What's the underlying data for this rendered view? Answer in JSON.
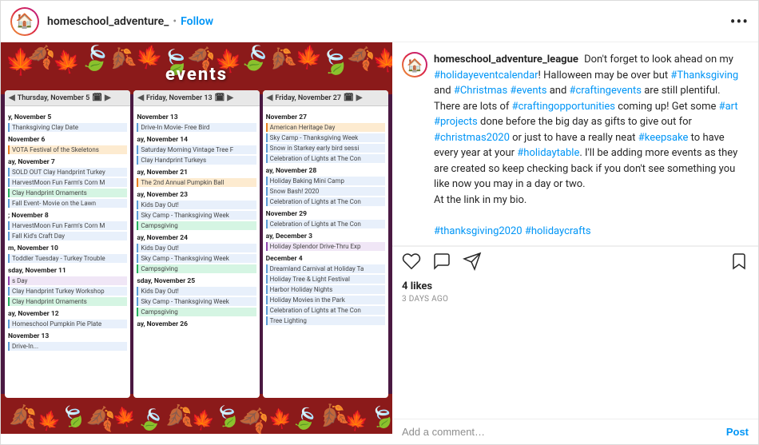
{
  "header": {
    "username": "homeschool_adventure_",
    "follow_label": "Follow",
    "more_label": "•••",
    "dot": "•"
  },
  "post": {
    "image_alt": "Holiday event calendar screenshot"
  },
  "caption": {
    "username": "homeschool_adventure_league",
    "text_parts": [
      {
        "text": "Don't forget to look ahead on my "
      },
      {
        "text": "#holidayeventcalendar",
        "type": "hashtag"
      },
      {
        "text": "! Halloween may be over but "
      },
      {
        "text": "#Thanksgiving",
        "type": "hashtag"
      },
      {
        "text": " and "
      },
      {
        "text": "#Christmas",
        "type": "hashtag"
      },
      {
        "text": " "
      },
      {
        "text": "#events",
        "type": "hashtag"
      },
      {
        "text": " and "
      },
      {
        "text": "#craftingevents",
        "type": "hashtag"
      },
      {
        "text": " are still plentiful. There are lots of "
      },
      {
        "text": "#craftingopportunities",
        "type": "hashtag"
      },
      {
        "text": " coming up! Get some "
      },
      {
        "text": "#art",
        "type": "hashtag"
      },
      {
        "text": " "
      },
      {
        "text": "#projects",
        "type": "hashtag"
      },
      {
        "text": " done before the big day as gifts to give out for "
      },
      {
        "text": "#christmas2020",
        "type": "hashtag"
      },
      {
        "text": " or just to have a really neat "
      },
      {
        "text": "#keepsake",
        "type": "hashtag"
      },
      {
        "text": " to have every year at your "
      },
      {
        "text": "#holidaytable",
        "type": "hashtag"
      },
      {
        "text": ". I'll be adding more events as they are created so keep checking back if you don't see something you like now you may in a day or two.\nAt the link in my bio."
      },
      {
        "text": "\n\n"
      },
      {
        "text": "#thanksgiving2020 #holidaycrafts",
        "type": "hashtag"
      }
    ]
  },
  "stats": {
    "likes": "4 likes",
    "time_ago": "3 days ago"
  },
  "add_comment": {
    "placeholder": "Add a comment…",
    "post_label": "Post"
  },
  "calendar": {
    "columns": [
      {
        "header": "Thursday, November 5",
        "events": [
          {
            "date": "y, November 5"
          },
          {
            "text": "Thanksgiving Clay Date"
          },
          {
            "date": "November 6"
          },
          {
            "text": "VOTA Festival of the Skeletons"
          },
          {
            "date": "ay, November 7"
          },
          {
            "text": "SOLD OUT Clay Handprint Turkey"
          },
          {
            "text": "HarvestMoon Fun Farm's Corn M"
          },
          {
            "text": "Clay Handprint Ornaments"
          },
          {
            "text": "Fall Event- Movie on the Lawn"
          },
          {
            "date": "; November 8"
          },
          {
            "text": "HarvestMoon Fun Farm's Corn M"
          },
          {
            "text": "Fall Kid's Craft Day"
          },
          {
            "date": "m, November 10"
          },
          {
            "text": "Toddler Tuesday - Turkey Trouble"
          },
          {
            "date": "sday, November 11"
          },
          {
            "text": "s Day"
          },
          {
            "text": "Clay Handprint Turkey Workshop"
          },
          {
            "text": "Clay Handprint Ornaments"
          },
          {
            "date": "ay, November 12"
          },
          {
            "text": "Homeschool Pumpkin Pie Plate"
          },
          {
            "date": "November 13"
          },
          {
            "text": "Drive-In..."
          }
        ]
      },
      {
        "header": "Friday, November 13",
        "events": [
          {
            "date": "November 13"
          },
          {
            "text": "Drive-In Movie- Free Bird"
          },
          {
            "date": "ay, November 14"
          },
          {
            "text": "Saturday Morning Vintage Tree F"
          },
          {
            "text": "Clay Handprint Turkeys"
          },
          {
            "date": "ay, November 21"
          },
          {
            "text": "The 2nd Annual Pumpkin Ball"
          },
          {
            "date": "ay, November 23"
          },
          {
            "text": "Kids Day Out!"
          },
          {
            "text": "Sky Camp - Thanksgiving Week"
          },
          {
            "text": "Campsgiving"
          },
          {
            "date": "ay, November 24"
          },
          {
            "text": "Kids Day Out!"
          },
          {
            "text": "Sky Camp - Thanksgiving Week"
          },
          {
            "text": "Campsgiving"
          },
          {
            "date": "sday, November 25"
          },
          {
            "text": "Kids Day Out!"
          },
          {
            "text": "Sky Camp - Thanksgiving Week"
          },
          {
            "text": "Campsgiving"
          },
          {
            "date": "ay, November 26"
          }
        ]
      },
      {
        "header": "Friday, November 27",
        "events": [
          {
            "date": "November 27"
          },
          {
            "text": "American Heritage Day"
          },
          {
            "text": "Sky Camp - Thanksgiving Week"
          },
          {
            "text": "Snow in Starkey early bird sessi"
          },
          {
            "text": "Celebration of Lights at The Con"
          },
          {
            "date": "ay, November 28"
          },
          {
            "text": "Holiday Baking Mini Camp"
          },
          {
            "text": "Snow Bash! 2020"
          },
          {
            "text": "Celebration of Lights at The Con"
          },
          {
            "date": "November 29"
          },
          {
            "text": "Celebration of Lights at The Con"
          },
          {
            "date": "ay, December 3"
          },
          {
            "text": "Holiday Splendor Drive-Thru Exp"
          },
          {
            "date": "December 4"
          },
          {
            "text": "Dreamland Carnival at Holiday Ta"
          },
          {
            "text": "Holiday Tree & Light Festival"
          },
          {
            "text": "Harbor Holiday Nights"
          },
          {
            "text": "Holiday Movies in the Park"
          },
          {
            "text": "Celebration of Lights at The Con"
          },
          {
            "text": "Tree Lighting"
          }
        ]
      }
    ]
  },
  "leaves": [
    "🍂",
    "🍁",
    "🍃",
    "🍂",
    "🍁",
    "🍃",
    "🍂",
    "🍁",
    "🍃",
    "🍂",
    "🍁",
    "🍃",
    "🍂",
    "🍁",
    "🍃",
    "🍂",
    "🍁",
    "🍃"
  ]
}
